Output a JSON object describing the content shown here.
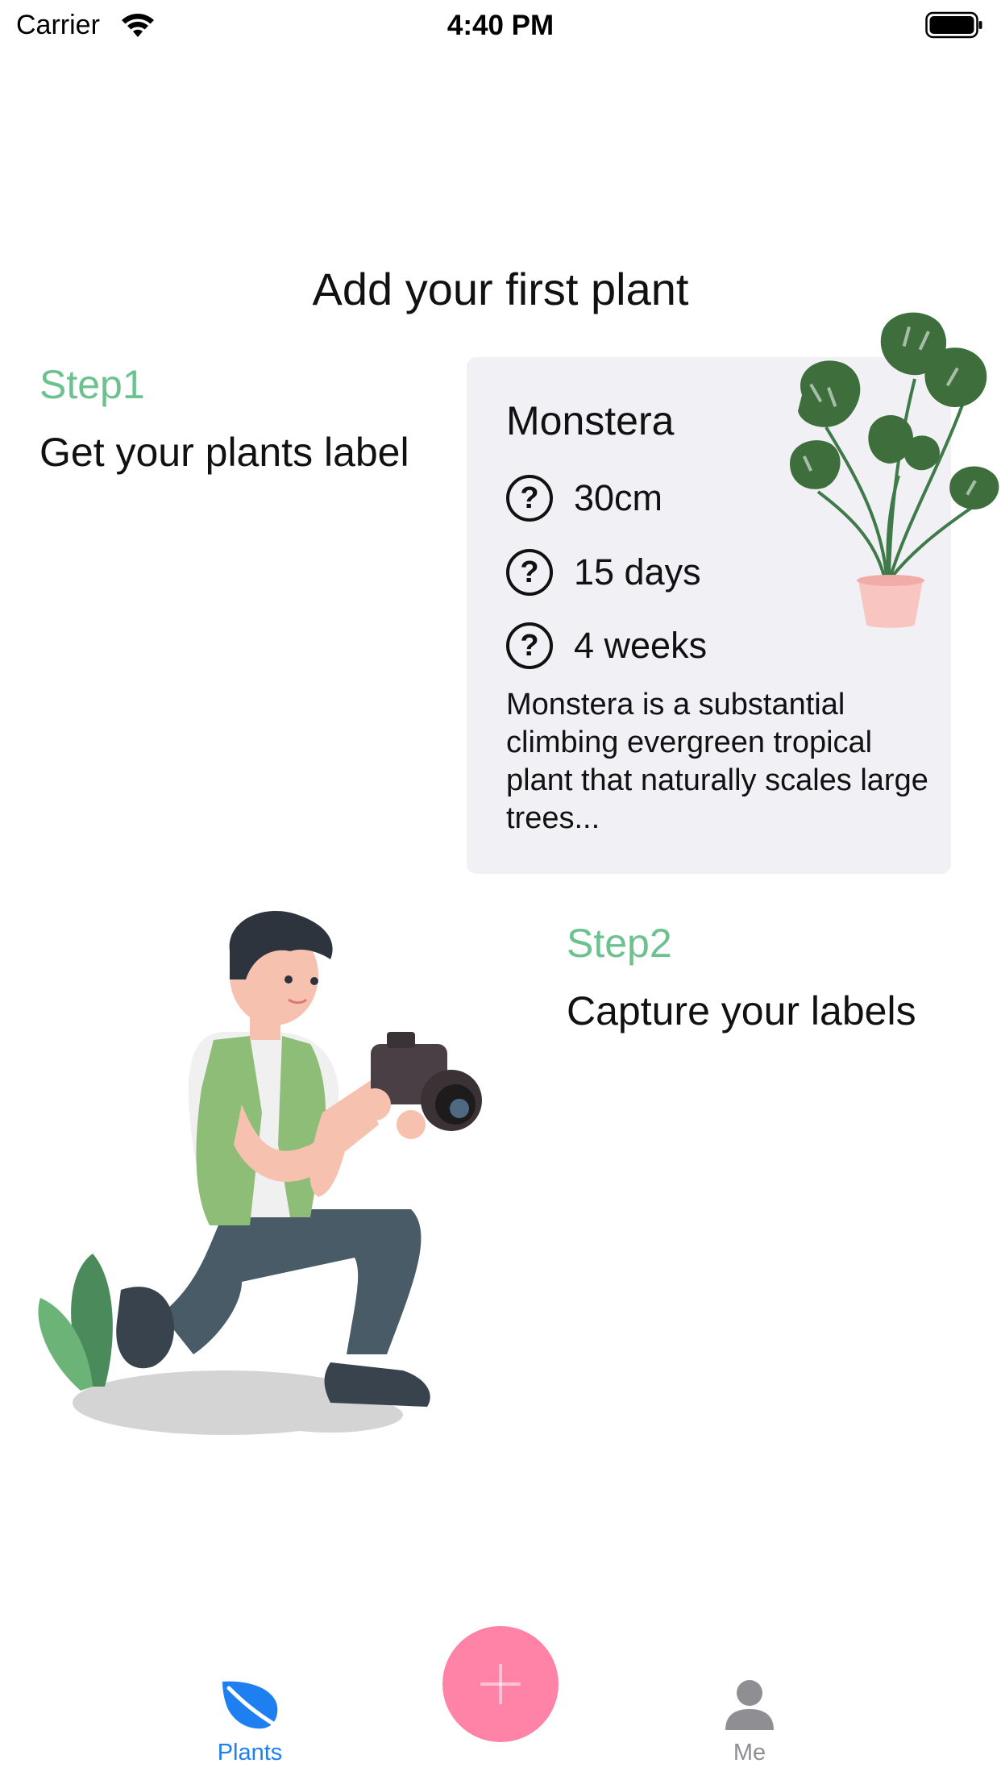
{
  "status_bar": {
    "carrier": "Carrier",
    "time": "4:40 PM"
  },
  "main": {
    "title": "Add your first plant",
    "step1": {
      "label": "Step1",
      "text": "Get your plants label"
    },
    "step2": {
      "label": "Step2",
      "text": "Capture your labels"
    },
    "card": {
      "name": "Monstera",
      "rows": [
        {
          "icon": "question-circle-icon",
          "value": "30cm"
        },
        {
          "icon": "question-circle-icon",
          "value": "15 days"
        },
        {
          "icon": "question-circle-icon",
          "value": "4 weeks"
        }
      ],
      "description": "Monstera is a substantial climbing evergreen tropical plant that naturally scales large trees..."
    }
  },
  "tabbar": {
    "plants_label": "Plants",
    "me_label": "Me",
    "add_icon": "plus-icon",
    "active_color": "#1e7ff0",
    "inactive_color": "#8e8e93",
    "add_color": "#fe83a6"
  },
  "colors": {
    "step_accent": "#6cc28f",
    "card_bg": "#f1f0f5"
  }
}
